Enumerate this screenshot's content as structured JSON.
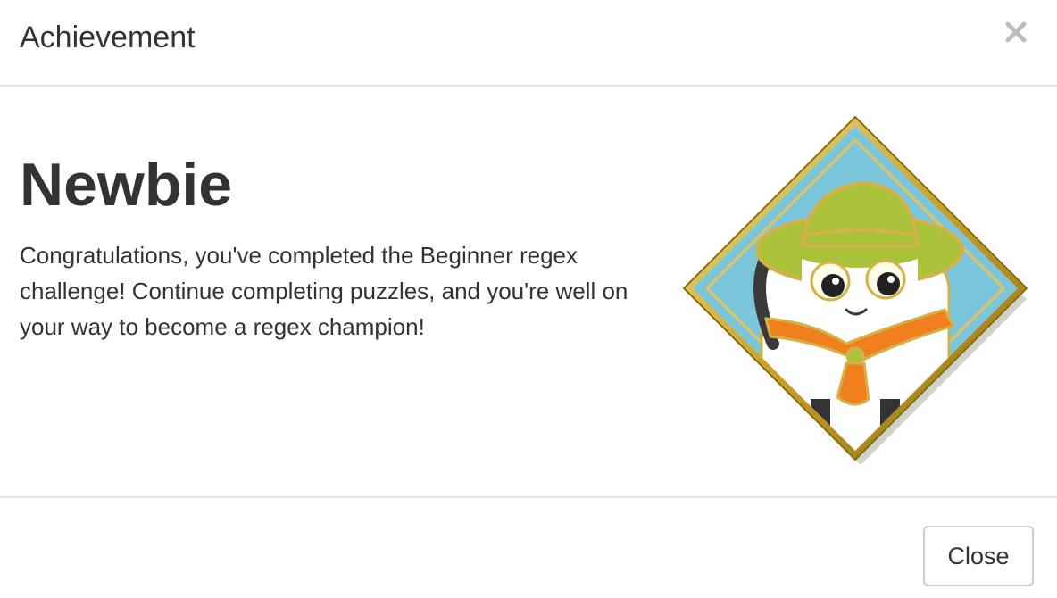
{
  "modal": {
    "title": "Achievement",
    "close_icon": "close-icon"
  },
  "achievement": {
    "name": "Newbie",
    "description": "Congratulations, you've completed the Beginner regex challenge! Continue completing puzzles, and you're well on your way to become a regex champion!",
    "badge_icon": "scout-badge-icon"
  },
  "footer": {
    "close_label": "Close"
  },
  "colors": {
    "text": "#333333",
    "divider": "#e5e5e5",
    "badge_sky": "#7cc6dc",
    "badge_gold": "#c9a227",
    "hat_green": "#a9c23a",
    "scarf_orange": "#f07f1e"
  }
}
